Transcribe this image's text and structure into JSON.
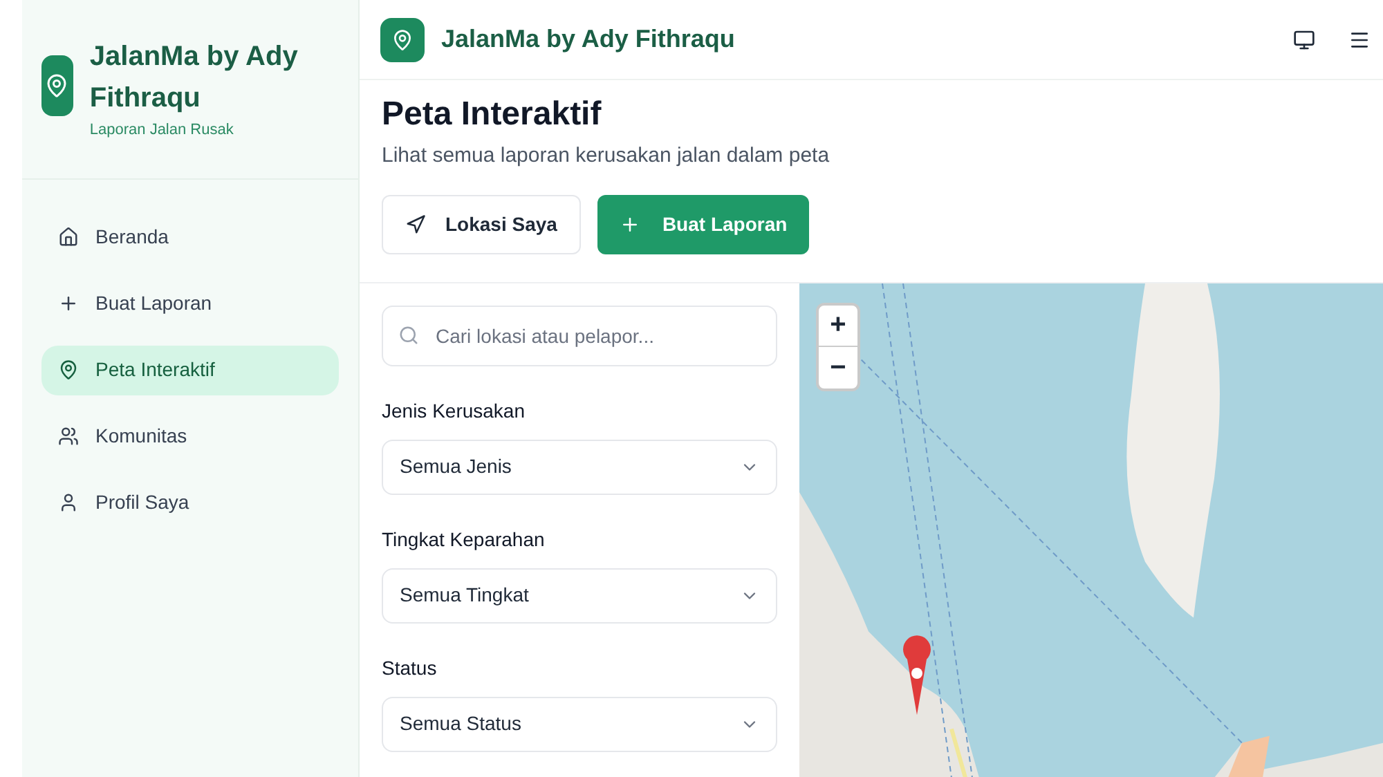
{
  "sidebar": {
    "brand": {
      "title": "JalanMa by Ady Fithraqu",
      "subtitle": "Laporan Jalan Rusak"
    },
    "items": [
      {
        "label": "Beranda",
        "selected": false
      },
      {
        "label": "Buat Laporan",
        "selected": false
      },
      {
        "label": "Peta Interaktif",
        "selected": true
      },
      {
        "label": "Komunitas",
        "selected": false
      },
      {
        "label": "Profil Saya",
        "selected": false
      }
    ]
  },
  "header": {
    "title": "JalanMa by Ady Fithraqu"
  },
  "page": {
    "title": "Peta Interaktif",
    "subtitle": "Lihat semua laporan kerusakan jalan dalam peta",
    "buttons": [
      {
        "label": "Lokasi Saya",
        "kind": "secondary"
      },
      {
        "label": "Buat Laporan",
        "kind": "primary"
      }
    ]
  },
  "filters": {
    "search": {
      "placeholder": "Cari lokasi atau pelapor..."
    },
    "selects": [
      {
        "label": "Jenis Kerusakan",
        "value": "Semua Jenis"
      },
      {
        "label": "Tingkat Keparahan",
        "value": "Semua Tingkat"
      },
      {
        "label": "Status",
        "value": "Semua Status"
      }
    ]
  },
  "map": {
    "kind": "picture",
    "zoom_in": "+",
    "zoom_out": "−"
  }
}
